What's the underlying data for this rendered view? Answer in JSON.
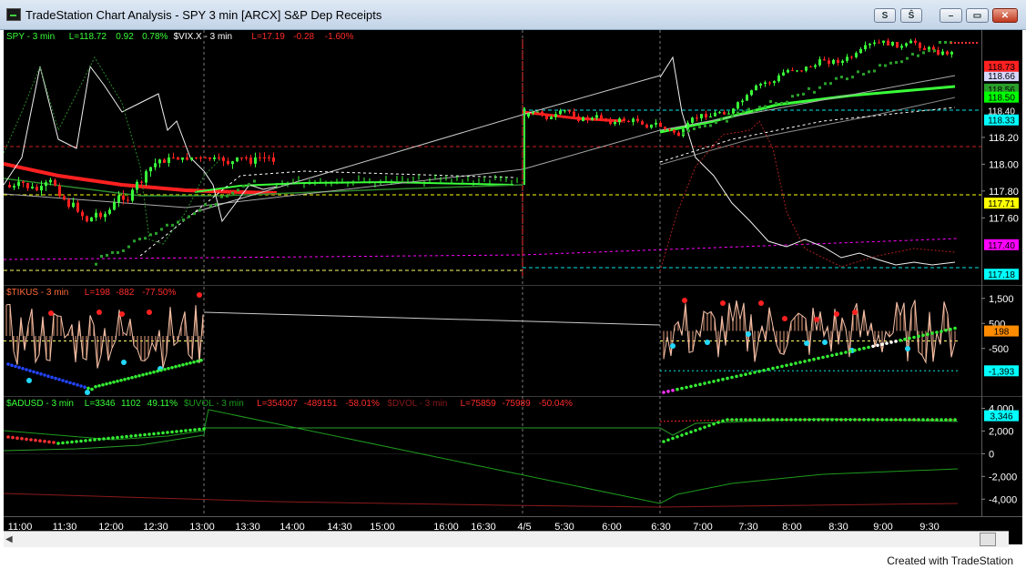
{
  "window": {
    "title": "TradeStation Chart Analysis - SPY 3 min [ARCX] S&P Dep Receipts",
    "buttons": {
      "s": "S",
      "sz": "Ŝ",
      "minimize": "–",
      "restore": "▭",
      "close": "✕"
    },
    "footer": "Created with TradeStation"
  },
  "chart_data": [
    {
      "type": "line",
      "panel": "price",
      "header": [
        {
          "text": "SPY - 3 min",
          "color": "#39ff39"
        },
        {
          "text": "L=118.72",
          "color": "#39ff39"
        },
        {
          "text": "0.92",
          "color": "#39ff39"
        },
        {
          "text": "0.78%",
          "color": "#39ff39"
        },
        {
          "text": "$VIX.X - 3 min",
          "color": "#ffffff"
        },
        {
          "text": "L=17.19",
          "color": "#ff2b2b"
        },
        {
          "text": "-0.28",
          "color": "#ff2b2b"
        },
        {
          "text": "-1.60%",
          "color": "#ff2b2b"
        }
      ],
      "y_ticks": [
        "118.20",
        "118.00",
        "117.80",
        "117.60"
      ],
      "ylim": [
        117.1,
        119.0
      ],
      "price_tags": [
        {
          "text": "118.66",
          "bg": "#d7d7ff",
          "color": "#000000",
          "value": 118.66
        },
        {
          "text": "118.56",
          "bg": "#2aa02a",
          "color": "#000000",
          "value": 118.56
        },
        {
          "text": "118.50",
          "bg": "#00ff00",
          "color": "#000000",
          "value": 118.5
        },
        {
          "text": "118.40",
          "bg": "#000000",
          "color": "#ffffff",
          "value": 118.4
        },
        {
          "text": "118.33",
          "bg": "#00ffff",
          "color": "#000000",
          "value": 118.33
        },
        {
          "text": "117.71",
          "bg": "#ffff00",
          "color": "#000000",
          "value": 117.71
        },
        {
          "text": "117.40",
          "bg": "#ff00ff",
          "color": "#000000",
          "value": 117.4
        },
        {
          "text": "117.18",
          "bg": "#00ffff",
          "color": "#000000",
          "value": 117.18
        },
        {
          "text": "118.73",
          "bg": "#ff2020",
          "color": "#000000",
          "value": 118.73
        }
      ]
    },
    {
      "type": "line",
      "panel": "tick",
      "header": [
        {
          "text": "$TIKUS - 3 min",
          "color": "#ff6a3a"
        },
        {
          "text": "L=198",
          "color": "#ff2b2b"
        },
        {
          "text": "-882",
          "color": "#ff2b2b"
        },
        {
          "text": "-77.50%",
          "color": "#ff2b2b"
        }
      ],
      "y_ticks": [
        "1,500",
        "500",
        "-500"
      ],
      "ylim": [
        -2400,
        2000
      ],
      "price_tags": [
        {
          "text": "198",
          "bg": "#ff8c00",
          "color": "#000000",
          "value": 198
        },
        {
          "text": "-1,393",
          "bg": "#00ffff",
          "color": "#000000",
          "value": -1393
        }
      ]
    },
    {
      "type": "line",
      "panel": "breadth",
      "header": [
        {
          "text": "$ADUSD - 3 min",
          "color": "#39ff39"
        },
        {
          "text": "L=3346",
          "color": "#39ff39"
        },
        {
          "text": "1102",
          "color": "#39ff39"
        },
        {
          "text": "49.11%",
          "color": "#39ff39"
        },
        {
          "text": "$UVOL - 3 min",
          "color": "#1e9a1e"
        },
        {
          "text": "L=354007",
          "color": "#ff2b2b"
        },
        {
          "text": "-489151",
          "color": "#ff2b2b"
        },
        {
          "text": "-58.01%",
          "color": "#ff2b2b"
        },
        {
          "text": "$DVOL - 3 min",
          "color": "#8b1a1a"
        },
        {
          "text": "L=75859",
          "color": "#ff2b2b"
        },
        {
          "text": "-75989",
          "color": "#ff2b2b"
        },
        {
          "text": "-50.04%",
          "color": "#ff2b2b"
        }
      ],
      "y_ticks": [
        "4,000",
        "2,000",
        "0",
        "-2,000",
        "-4,000"
      ],
      "ylim": [
        -5500,
        5000
      ],
      "price_tags": [
        {
          "text": "3,346",
          "bg": "#00ffff",
          "color": "#000000",
          "value": 3346
        }
      ]
    }
  ],
  "x_axis": {
    "labels": [
      "11:00",
      "11:30",
      "12:00",
      "12:30",
      "13:00",
      "13:30",
      "14:00",
      "14:30",
      "15:00",
      "16:00",
      "16:30",
      "4/5",
      "5:30",
      "6:00",
      "6:30",
      "7:00",
      "7:30",
      "8:00",
      "8:30",
      "9:00",
      "9:30"
    ]
  }
}
